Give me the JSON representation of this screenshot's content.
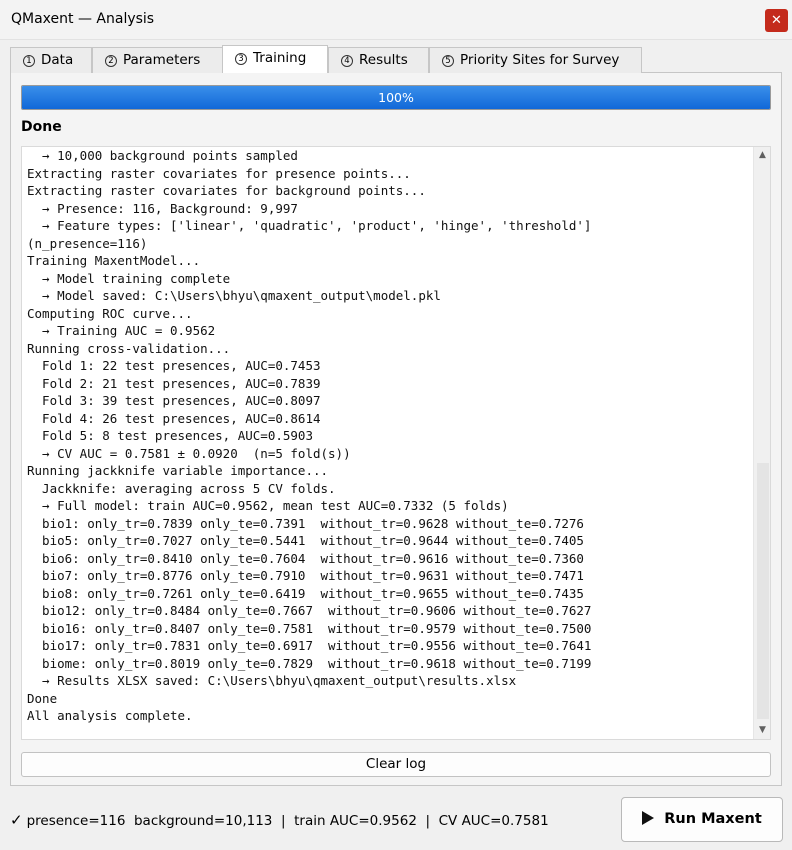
{
  "window": {
    "title": "QMaxent — Analysis",
    "close_glyph": "✕"
  },
  "tabs": [
    {
      "num": "1",
      "label": "Data"
    },
    {
      "num": "2",
      "label": "Parameters"
    },
    {
      "num": "3",
      "label": "Training",
      "active": true
    },
    {
      "num": "4",
      "label": "Results"
    },
    {
      "num": "5",
      "label": "Priority Sites for Survey"
    }
  ],
  "progress": {
    "value": 1.0,
    "label": "100%"
  },
  "status": "Done",
  "log": {
    "lines": [
      "  → 10,000 background points sampled",
      "Extracting raster covariates for presence points...",
      "Extracting raster covariates for background points...",
      "  → Presence: 116, Background: 9,997",
      "  → Feature types: ['linear', 'quadratic', 'product', 'hinge', 'threshold']",
      "(n_presence=116)",
      "Training MaxentModel...",
      "  → Model training complete",
      "  → Model saved: C:\\Users\\bhyu\\qmaxent_output\\model.pkl",
      "Computing ROC curve...",
      "  → Training AUC = 0.9562",
      "Running cross-validation...",
      "  Fold 1: 22 test presences, AUC=0.7453",
      "  Fold 2: 21 test presences, AUC=0.7839",
      "  Fold 3: 39 test presences, AUC=0.8097",
      "  Fold 4: 26 test presences, AUC=0.8614",
      "  Fold 5: 8 test presences, AUC=0.5903",
      "  → CV AUC = 0.7581 ± 0.0920  (n=5 fold(s))",
      "Running jackknife variable importance...",
      "  Jackknife: averaging across 5 CV folds.",
      "  → Full model: train AUC=0.9562, mean test AUC=0.7332 (5 folds)",
      "  bio1: only_tr=0.7839 only_te=0.7391  without_tr=0.9628 without_te=0.7276",
      "  bio5: only_tr=0.7027 only_te=0.5441  without_tr=0.9644 without_te=0.7405",
      "  bio6: only_tr=0.8410 only_te=0.7604  without_tr=0.9616 without_te=0.7360",
      "  bio7: only_tr=0.8776 only_te=0.7910  without_tr=0.9631 without_te=0.7471",
      "  bio8: only_tr=0.7261 only_te=0.6419  without_tr=0.9655 without_te=0.7435",
      "  bio12: only_tr=0.8484 only_te=0.7667  without_tr=0.9606 without_te=0.7627",
      "  bio16: only_tr=0.8407 only_te=0.7581  without_tr=0.9579 without_te=0.7500",
      "  bio17: only_tr=0.7831 only_te=0.6917  without_tr=0.9556 without_te=0.7641",
      "  biome: only_tr=0.8019 only_te=0.7829  without_tr=0.9618 without_te=0.7199",
      "  → Results XLSX saved: C:\\Users\\bhyu\\qmaxent_output\\results.xlsx",
      "Done",
      "All analysis complete."
    ]
  },
  "buttons": {
    "clear_log": "Clear log",
    "run": "Run Maxent"
  },
  "footer": {
    "check": "✓",
    "status": "presence=116  background=10,113  |  train AUC=0.9562  |  CV AUC=0.7581"
  },
  "colors": {
    "progress_fill": "#1a73e8",
    "close_button": "#c42b1c"
  },
  "icons": {
    "close": "close-icon",
    "run": "play-icon",
    "status": "checkmark-icon"
  }
}
